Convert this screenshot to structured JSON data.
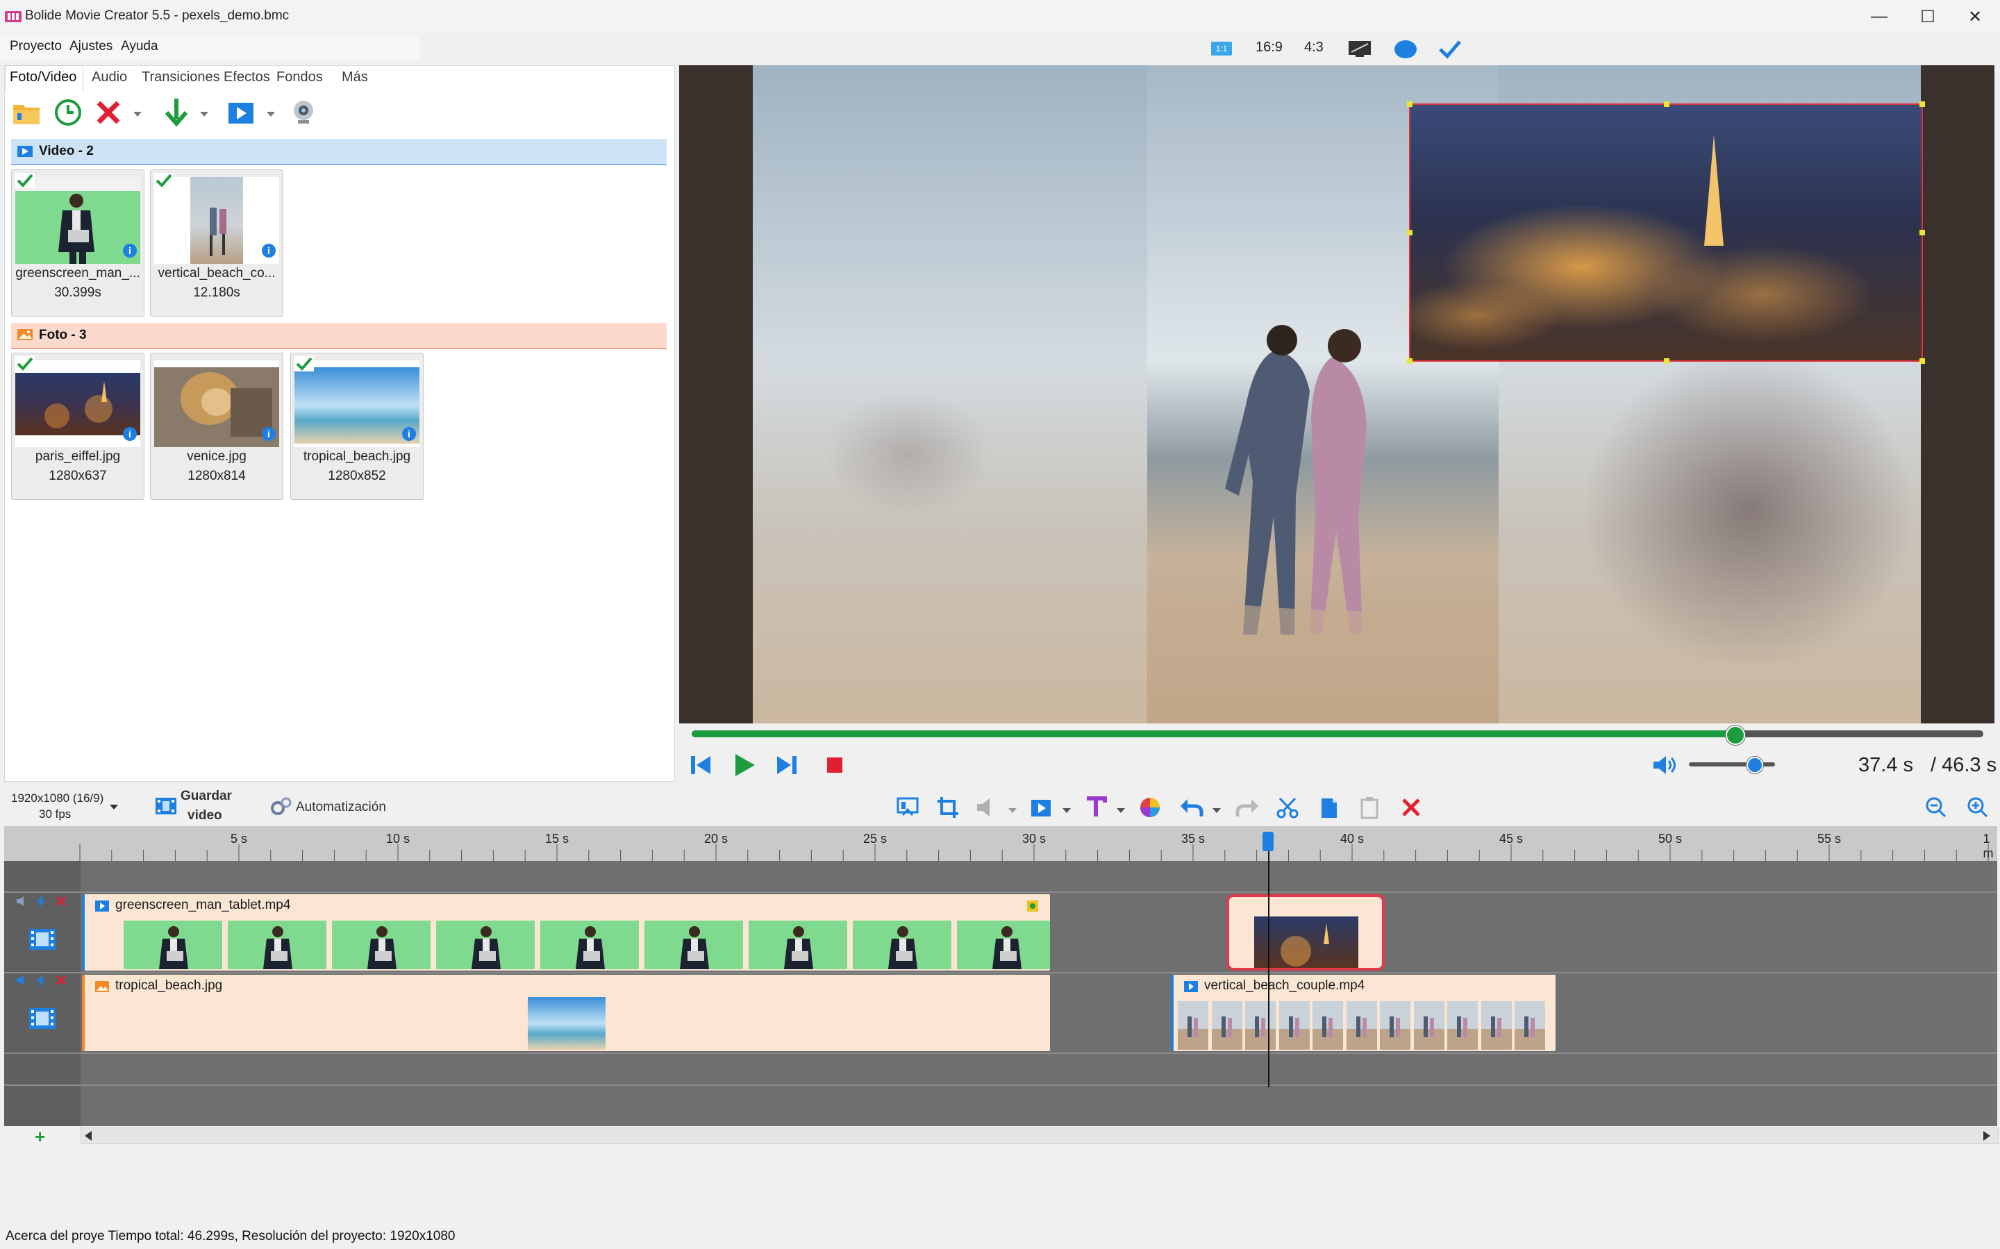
{
  "window": {
    "title": "Bolide Movie Creator 5.5 - pexels_demo.bmc",
    "minimize": "—",
    "maximize": "☐",
    "close": "✕"
  },
  "menu": [
    "Proyecto",
    "Ajustes",
    "Ayuda"
  ],
  "aspect": {
    "badge": "1:1",
    "ratio_169": "16:9",
    "ratio_43": "4:3"
  },
  "tabs": [
    "Foto/Video",
    "Audio",
    "Transiciones",
    "Efectos",
    "Fondos",
    "Más"
  ],
  "media": {
    "video_group": "Video - 2",
    "photo_group": "Foto - 3",
    "videos": [
      {
        "name": "greenscreen_man_...",
        "info": "30.399s"
      },
      {
        "name": "vertical_beach_co...",
        "info": "12.180s"
      }
    ],
    "photos": [
      {
        "name": "paris_eiffel.jpg",
        "info": "1280x637"
      },
      {
        "name": "venice.jpg",
        "info": "1280x814"
      },
      {
        "name": "tropical_beach.jpg",
        "info": "1280x852"
      }
    ],
    "info_glyph": "i"
  },
  "player": {
    "progress": 0.807,
    "volume": 0.75,
    "current_time": "37.4 s",
    "total_time": "/ 46.3 s"
  },
  "toolbar": {
    "resolution": "1920x1080 (16/9)",
    "fps": "30 fps",
    "save_line1": "Guardar",
    "save_line2": "video",
    "automation": "Automatización"
  },
  "timeline": {
    "ticks": [
      "5 s",
      "10 s",
      "15 s",
      "20 s",
      "25 s",
      "30 s",
      "35 s",
      "40 s",
      "45 s",
      "50 s",
      "55 s",
      "1 m"
    ],
    "clips": [
      {
        "name": "greenscreen_man_tablet.mp4"
      },
      {
        "name": "tropical_beach.jpg"
      },
      {
        "name": "vertical_beach_couple.mp4"
      }
    ],
    "add_track": "+"
  },
  "status": {
    "text": "Acerca del proye Tiempo total: 46.299s,    Resolución del proyecto:   1920x1080"
  },
  "colors": {
    "accent": "#1d7fe0",
    "progress": "#1c9c3c",
    "video_group_bg": "#cfe3f7",
    "photo_group_bg": "#fbd9cd",
    "clip_bg": "#fbe6d3",
    "selected_clip_border": "#e03a4a"
  }
}
